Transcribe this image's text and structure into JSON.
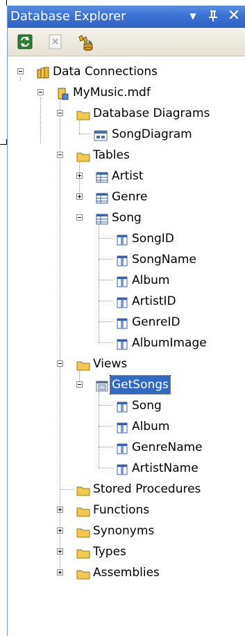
{
  "window": {
    "title": "Database Explorer",
    "dropdown_glyph": "▼",
    "pin_glyph": "ꟸ",
    "close_glyph": "✕"
  },
  "toolbar": {
    "refresh_icon": "refresh-icon",
    "cancel_icon": "cancel-icon",
    "connect_icon": "connect-to-database-icon"
  },
  "tree": {
    "data_connections": "Data Connections",
    "mymusic": "MyMusic.mdf",
    "database_diagrams": "Database Diagrams",
    "song_diagram": "SongDiagram",
    "tables": "Tables",
    "artist": "Artist",
    "genre": "Genre",
    "song": "Song",
    "song_columns": [
      "SongID",
      "SongName",
      "Album",
      "ArtistID",
      "GenreID",
      "AlbumImage"
    ],
    "views": "Views",
    "get_songs": "GetSongs",
    "view_columns": [
      "Song",
      "Album",
      "GenreName",
      "ArtistName"
    ],
    "stored_procedures": "Stored Procedures",
    "functions": "Functions",
    "synonyms": "Synonyms",
    "types": "Types",
    "assemblies": "Assemblies"
  },
  "colors": {
    "title_bar": "#3b73d4",
    "selection": "#316ac5",
    "folder": "#f2c94c"
  }
}
